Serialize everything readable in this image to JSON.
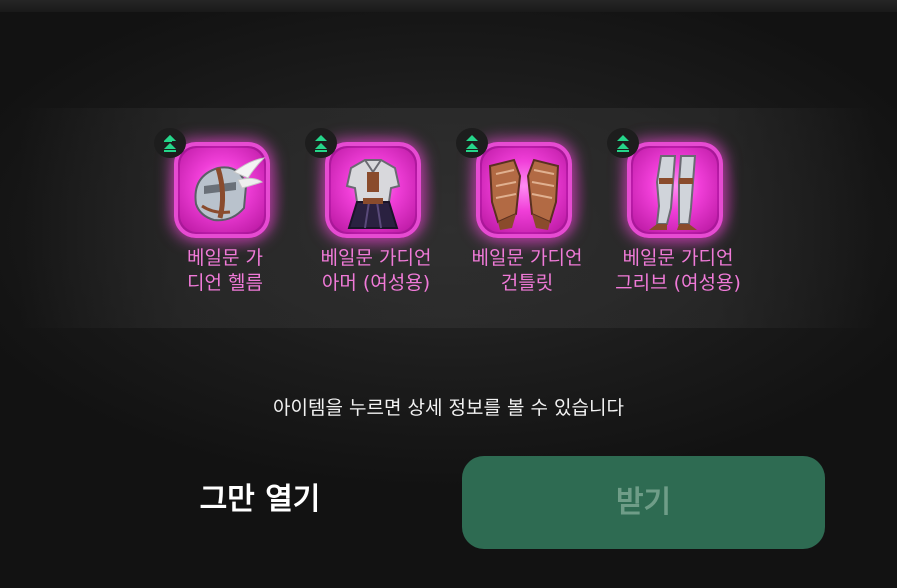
{
  "rewards": {
    "items": [
      {
        "name_line1": "베일문 가",
        "name_line2": "디언 헬름",
        "icon": "helm-icon",
        "rarity_color": "#ff3fe6",
        "upgrade_icon": "upgrade-arrow-icon"
      },
      {
        "name_line1": "베일문 가디언",
        "name_line2": "아머 (여성용)",
        "icon": "armor-icon",
        "rarity_color": "#ff3fe6",
        "upgrade_icon": "upgrade-arrow-icon"
      },
      {
        "name_line1": "베일문 가디언",
        "name_line2": "건틀릿",
        "icon": "gauntlet-icon",
        "rarity_color": "#ff3fe6",
        "upgrade_icon": "upgrade-arrow-icon"
      },
      {
        "name_line1": "베일문 가디언",
        "name_line2": "그리브 (여성용)",
        "icon": "greaves-icon",
        "rarity_color": "#ff3fe6",
        "upgrade_icon": "upgrade-arrow-icon"
      }
    ]
  },
  "hint_text": "아이템을 누르면 상세 정보를 볼 수 있습니다",
  "buttons": {
    "stop_label": "그만 열기",
    "receive_label": "받기"
  },
  "colors": {
    "item_label": "#f07ad8",
    "receive_button": "#2e6b52",
    "upgrade_arrow": "#25d68a"
  }
}
